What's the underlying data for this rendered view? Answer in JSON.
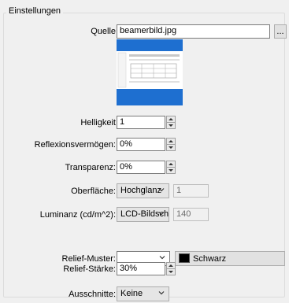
{
  "group": {
    "title": "Einstellungen"
  },
  "source": {
    "label": "Quelle",
    "value": "beamerbild.jpg",
    "browse_label": "..."
  },
  "brightness": {
    "label": "Helligkeit",
    "value": "1"
  },
  "reflectivity": {
    "label": "Reflexionsvermögen:",
    "value": "0%"
  },
  "transparency": {
    "label": "Transparenz:",
    "value": "0%"
  },
  "surface": {
    "label": "Oberfläche:",
    "selected": "Hochglanz",
    "extra_value": "1"
  },
  "luminance": {
    "label": "Luminanz (cd/m^2):",
    "selected": "LCD-Bildschirm",
    "extra_value": "140"
  },
  "relief_pattern": {
    "label": "Relief-Muster:",
    "selected": "",
    "color_label": "Schwarz",
    "color": "#000000"
  },
  "relief_strength": {
    "label": "Relief-Stärke:",
    "value": "30%"
  },
  "cutouts": {
    "label": "Ausschnitte:",
    "selected": "Keine"
  },
  "colors": {
    "preview_bg": "#1e6fd0",
    "preview_screen": "#ffffff"
  }
}
